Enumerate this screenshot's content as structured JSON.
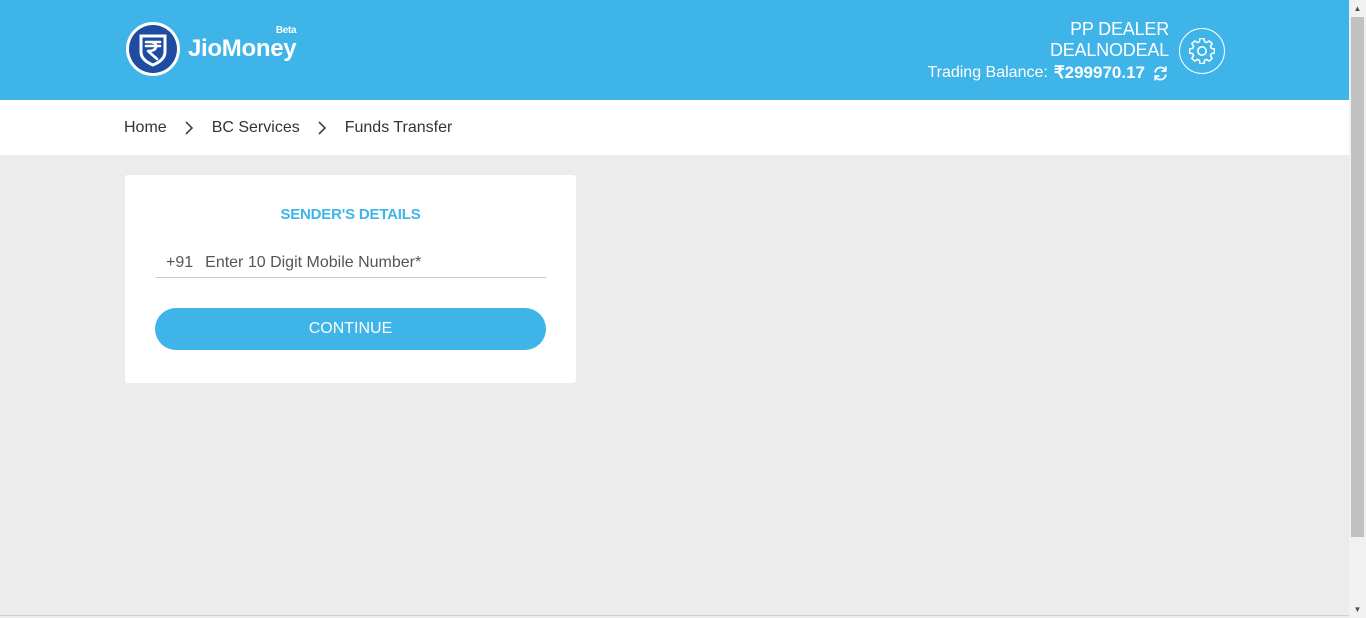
{
  "brand": {
    "name": "JioMoney",
    "badge": "Beta",
    "logo_icon": "rupee-shield-icon",
    "colors": {
      "primary": "#3eb4e9",
      "logo_dark": "#1f4ba0"
    }
  },
  "user": {
    "type": "PP DEALER",
    "name": "DEALNODEAL",
    "balance_label": "Trading Balance:",
    "balance_value": "₹299970.17"
  },
  "breadcrumb": {
    "items": [
      {
        "label": "Home"
      },
      {
        "label": "BC Services"
      },
      {
        "label": "Funds Transfer"
      }
    ]
  },
  "form": {
    "title": "SENDER'S DETAILS",
    "country_code": "+91",
    "mobile_placeholder": "Enter 10 Digit Mobile Number*",
    "mobile_value": "",
    "submit_label": "CONTINUE"
  }
}
